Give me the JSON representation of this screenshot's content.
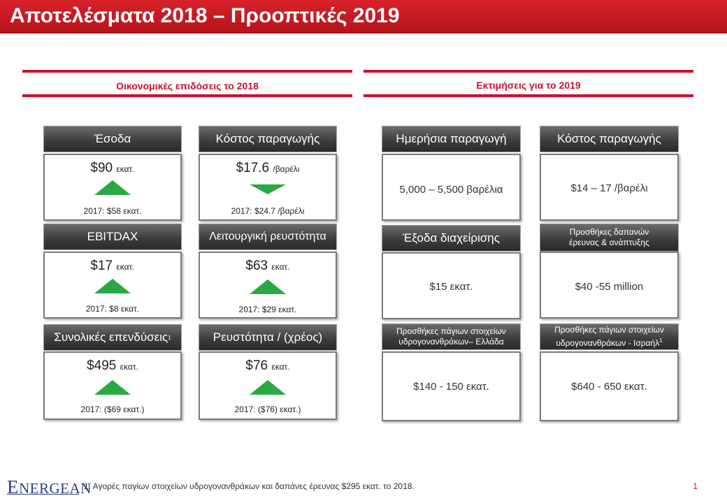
{
  "title": "Αποτελέσματα 2018 – Προοπτικές 2019",
  "sections": {
    "left": "Οικονομικές επιδόσεις το 2018",
    "right": "Εκτιμήσεις για το 2019"
  },
  "performance": [
    {
      "header": "Έσοδα",
      "value": "$90",
      "unit": "εκατ.",
      "trend": "up",
      "prior": "2017: $58 εκατ."
    },
    {
      "header": "Κόστος παραγωγής",
      "value": "$17.6",
      "unit": "/βαρέλι",
      "trend": "down",
      "prior": "2017: $24.7 /βαρέλι"
    },
    {
      "header": "EBITDAX",
      "value": "$17",
      "unit": "εκατ.",
      "trend": "up",
      "prior": "2017: $8 εκατ."
    },
    {
      "header": "Λειτουργική ρευστότητα",
      "value": "$63",
      "unit": "εκατ.",
      "trend": "up",
      "prior": "2017: $29 εκατ."
    },
    {
      "header": "Συνολικές επενδύσεις",
      "header_sup": "1",
      "value": "$495",
      "unit": "εκατ.",
      "trend": "up",
      "prior": "2017: ($69 εκατ.)"
    },
    {
      "header": "Ρευστότητα / (χρέος)",
      "value": "$76",
      "unit": "εκατ.",
      "trend": "up",
      "prior": "2017: ($76) εκατ.)"
    }
  ],
  "estimates": [
    {
      "header": "Ημερήσια παραγωγή",
      "value": "5,000 – 5,500 βαρέλια"
    },
    {
      "header": "Κόστος παραγωγής",
      "value": "$14 – 17 /βαρέλι"
    },
    {
      "header": "Έξοδα διαχείρισης",
      "value": "$15 εκατ."
    },
    {
      "header": "Προσθήκες δαπανών έρευνας & ανάπτυξης",
      "value": "$40 -55 million"
    },
    {
      "header": "Προσθήκες πάγιων στοιχείων υδρογονανθράκων– Ελλάδα",
      "value": "$140 - 150 εκατ."
    },
    {
      "header": "Προσθήκες πάγιων στοιχείων υδρογονανθράκων - Ισραήλ",
      "header_sup": "1",
      "value": "$640 - 650 εκατ."
    }
  ],
  "footnote": "1. Αγορές παγίων στοιχείων υδρογονανθράκων και δαπάνες έρευνας $295 εκατ. το 2018.",
  "page_number": "1",
  "logo_text": "Energean",
  "colors": {
    "brand_red": "#c8102e",
    "trend_green": "#2aa844",
    "header_gray": "#3e3e3e"
  }
}
